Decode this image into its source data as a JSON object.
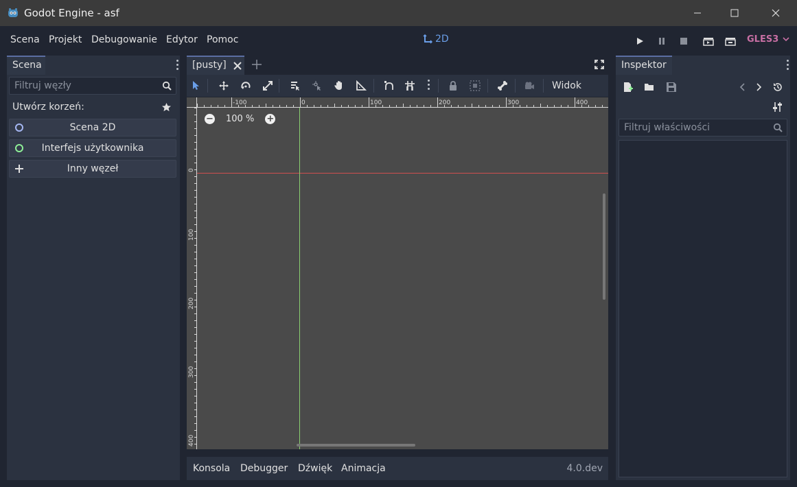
{
  "window": {
    "title": "Godot Engine - asf"
  },
  "menu": {
    "items": [
      "Scena",
      "Projekt",
      "Debugowanie",
      "Edytor",
      "Pomoc"
    ],
    "mode_label": "2D",
    "renderer": "GLES3"
  },
  "scene_dock": {
    "tab_label": "Scena",
    "filter_placeholder": "Filtruj węzły",
    "create_root_label": "Utwórz korzeń:",
    "buttons": [
      {
        "label": "Scena 2D",
        "color": "#a5b7f3"
      },
      {
        "label": "Interfejs użytkownika",
        "color": "#8eef97"
      },
      {
        "label": "Inny węzeł"
      }
    ]
  },
  "editor": {
    "scene_tab_label": "[pusty]",
    "view_menu_label": "Widok",
    "zoom_label": "100 %",
    "ruler_top_labels": [
      "-100",
      "0",
      "100",
      "200",
      "300",
      "400"
    ],
    "ruler_left_labels": [
      "0",
      "100",
      "200",
      "300",
      "400"
    ]
  },
  "bottom_panel": {
    "items": [
      "Konsola",
      "Debugger",
      "Dźwięk",
      "Animacja"
    ],
    "version": "4.0.dev"
  },
  "inspector": {
    "tab_label": "Inspektor",
    "filter_placeholder": "Filtruj właściwości"
  },
  "colors": {
    "accent": "#6a9ee8",
    "renderer": "#c86fa4",
    "x_axis": "#d05050",
    "y_axis": "#8ad070"
  }
}
